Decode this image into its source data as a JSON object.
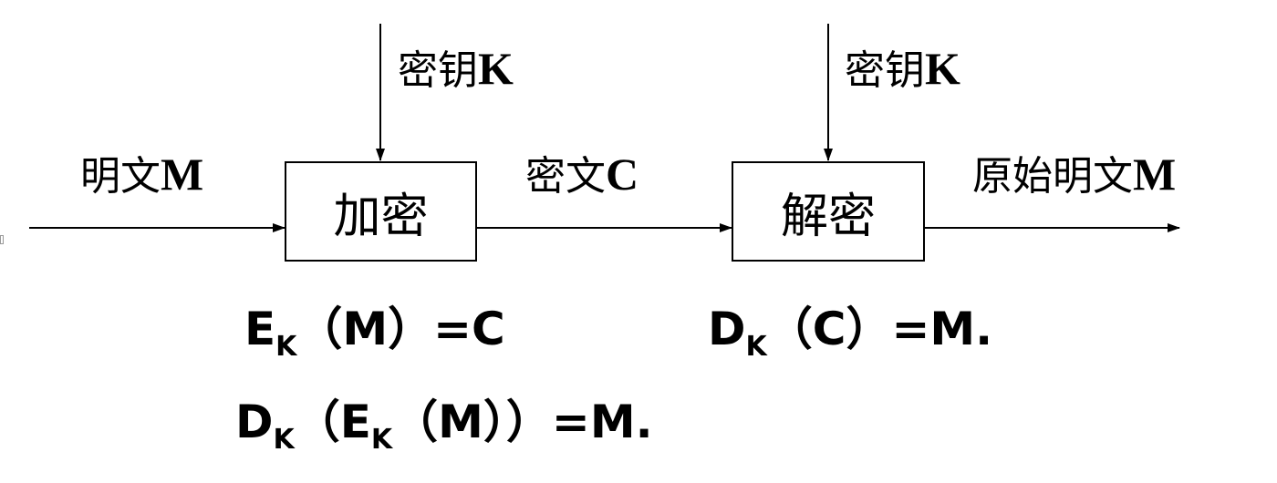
{
  "diagram": {
    "input_label_prefix": "明文",
    "input_label_var": "M",
    "encrypt_key_prefix": "密钥",
    "encrypt_key_var": "K",
    "encrypt_box": "加密",
    "cipher_label_prefix": "密文",
    "cipher_label_var": "C",
    "decrypt_key_prefix": "密钥",
    "decrypt_key_var": "K",
    "decrypt_box": "解密",
    "output_label_prefix": "原始明文",
    "output_label_var": "M"
  },
  "formulas": {
    "encrypt": {
      "fn": "E",
      "sub": "K",
      "rest": "（M）=C"
    },
    "decrypt": {
      "fn": "D",
      "sub": "K",
      "rest": "（C）=M."
    },
    "combined": {
      "fn_outer": "D",
      "sub_outer": "K",
      "open": "（",
      "fn_inner": "E",
      "sub_inner": "K",
      "rest": "（M））=M."
    }
  }
}
